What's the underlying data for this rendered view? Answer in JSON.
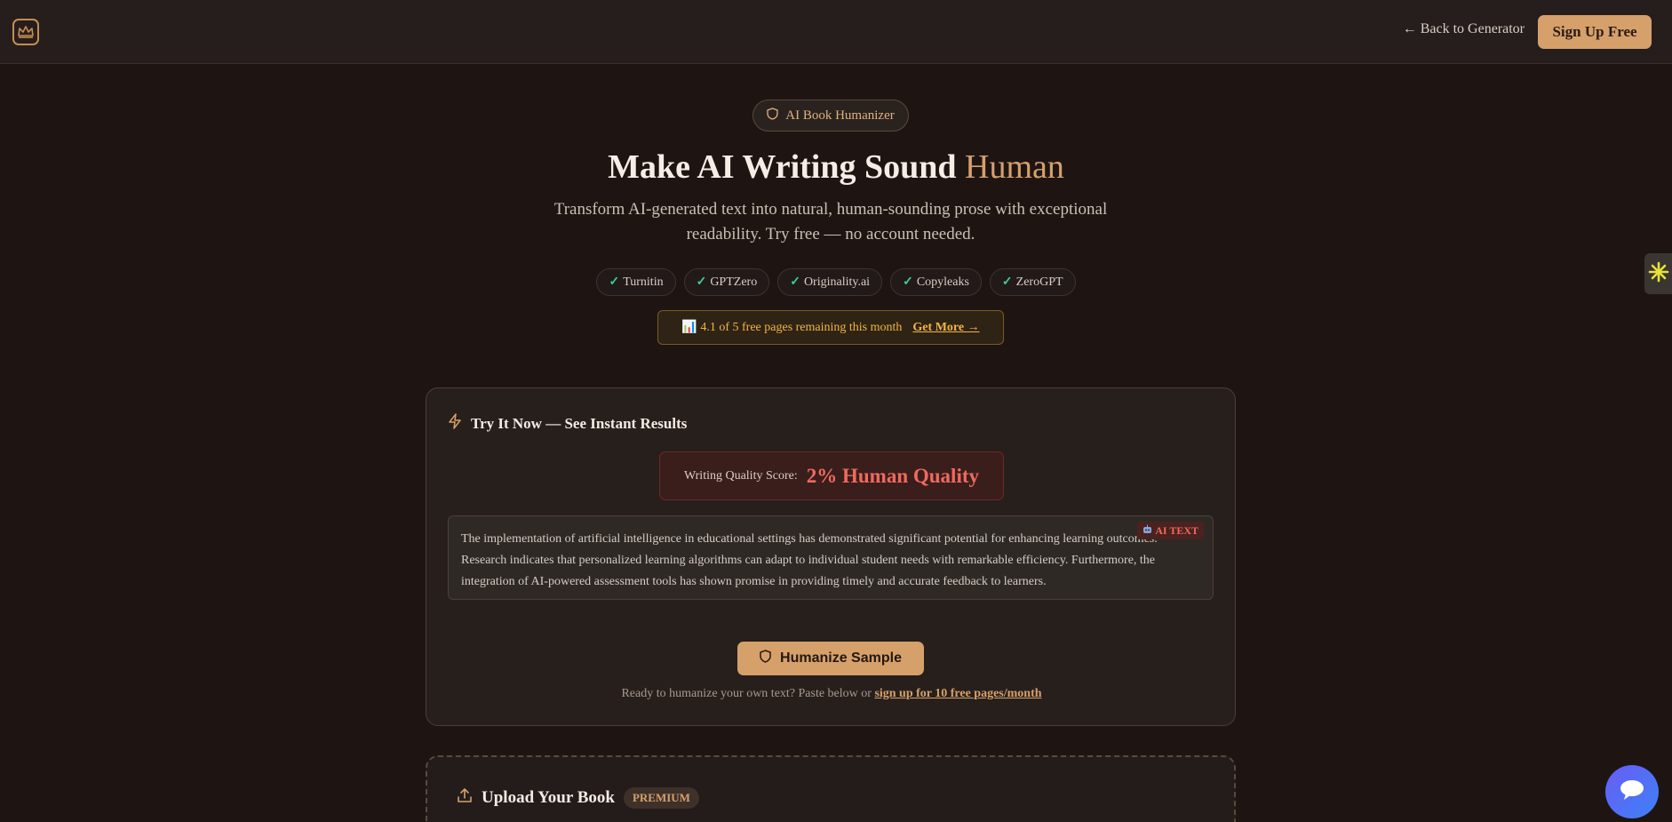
{
  "header": {
    "back_label": "← Back to Generator",
    "signup_label": "Sign Up Free"
  },
  "hero": {
    "pill_label": "AI Book Humanizer",
    "title_main": "Make AI Writing Sound ",
    "title_accent": "Human",
    "subtitle": "Transform AI-generated text into natural, human-sounding prose with exceptional readability. Try free — no account needed.",
    "detectors": [
      {
        "tick": "✓",
        "label": "Turnitin"
      },
      {
        "tick": "✓",
        "label": "GPTZero"
      },
      {
        "tick": "✓",
        "label": "Originality.ai"
      },
      {
        "tick": "✓",
        "label": "Copyleaks"
      },
      {
        "tick": "✓",
        "label": "ZeroGPT"
      }
    ],
    "quota_text": "📊 4.1 of 5 free pages remaining this month",
    "quota_link": "Get More →"
  },
  "try_card": {
    "title": "Try It Now — See Instant Results",
    "score_label": "Writing Quality Score:",
    "score_value": "2% Human Quality",
    "ai_badge": "AI TEXT",
    "sample_text": "The implementation of artificial intelligence in educational settings has demonstrated significant potential for enhancing learning outcomes. Research indicates that personalized learning algorithms can adapt to individual student needs with remarkable efficiency. Furthermore, the integration of AI-powered assessment tools has shown promise in providing timely and accurate feedback to learners.",
    "humanize_label": "Humanize Sample",
    "cta_text": "Ready to humanize your own text? Paste below or ",
    "cta_link": "sign up for 10 free pages/month"
  },
  "upload": {
    "title": "Upload Your Book",
    "badge": "PREMIUM"
  },
  "colors": {
    "background": "#1e1513",
    "accent": "#d6a06b",
    "danger": "#ef6a5e",
    "success": "#3ecf8e",
    "warning": "#f3b544"
  }
}
